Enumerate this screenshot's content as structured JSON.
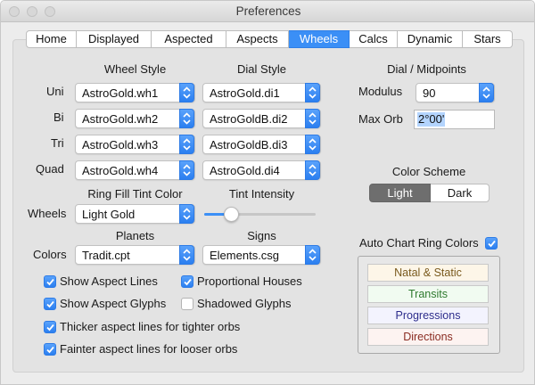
{
  "window": {
    "title": "Preferences"
  },
  "tabs": [
    {
      "label": "Home",
      "active": false
    },
    {
      "label": "Displayed",
      "active": false
    },
    {
      "label": "Aspected",
      "active": false
    },
    {
      "label": "Aspects",
      "active": false
    },
    {
      "label": "Wheels",
      "active": true
    },
    {
      "label": "Calcs",
      "active": false
    },
    {
      "label": "Dynamic",
      "active": false
    },
    {
      "label": "Stars",
      "active": false
    }
  ],
  "wheel_style": {
    "header": "Wheel Style",
    "dial_header": "Dial Style",
    "rows": [
      {
        "label": "Uni",
        "wheel": "AstroGold.wh1",
        "dial": "AstroGold.di1"
      },
      {
        "label": "Bi",
        "wheel": "AstroGold.wh2",
        "dial": "AstroGoldB.di2"
      },
      {
        "label": "Tri",
        "wheel": "AstroGold.wh3",
        "dial": "AstroGoldB.di3"
      },
      {
        "label": "Quad",
        "wheel": "AstroGold.wh4",
        "dial": "AstroGold.di4"
      }
    ]
  },
  "tint": {
    "fill_header": "Ring Fill Tint Color",
    "intensity_header": "Tint Intensity",
    "row_label": "Wheels",
    "fill_value": "Light Gold",
    "intensity_fraction": 0.24
  },
  "colors": {
    "planets_header": "Planets",
    "signs_header": "Signs",
    "row_label": "Colors",
    "planets_value": "Tradit.cpt",
    "signs_value": "Elements.csg"
  },
  "dial": {
    "header": "Dial / Midpoints",
    "modulus_label": "Modulus",
    "modulus_value": "90",
    "maxorb_label": "Max Orb",
    "maxorb_value": "2°00'"
  },
  "color_scheme": {
    "header": "Color Scheme",
    "light": "Light",
    "dark": "Dark",
    "selected": "Light"
  },
  "auto_ring": {
    "label": "Auto Chart Ring Colors",
    "checked": true,
    "buttons": [
      {
        "label": "Natal & Static",
        "bg": "#fdf6e8",
        "fg": "#7a5a1e"
      },
      {
        "label": "Transits",
        "bg": "#f1fbf1",
        "fg": "#2f7a2f"
      },
      {
        "label": "Progressions",
        "bg": "#f3f3fe",
        "fg": "#2e2e8c"
      },
      {
        "label": "Directions",
        "bg": "#fdf3f1",
        "fg": "#8a2c22"
      }
    ]
  },
  "options": {
    "show_aspect_lines": {
      "label": "Show Aspect Lines",
      "checked": true
    },
    "proportional_houses": {
      "label": "Proportional Houses",
      "checked": true
    },
    "show_aspect_glyphs": {
      "label": "Show Aspect Glyphs",
      "checked": true
    },
    "shadowed_glyphs": {
      "label": "Shadowed Glyphs",
      "checked": false
    },
    "thicker_lines": {
      "label": "Thicker aspect lines for tighter orbs",
      "checked": true
    },
    "fainter_lines": {
      "label": "Fainter aspect lines for looser orbs",
      "checked": true
    }
  },
  "accent_color": "#3b8ff6"
}
